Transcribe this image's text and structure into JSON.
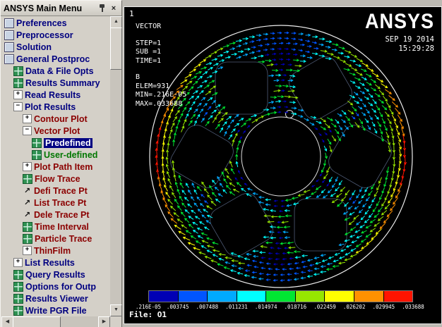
{
  "window": {
    "title": "ANSYS Main Menu"
  },
  "icons": {
    "close": "×",
    "scroll_up": "▲",
    "scroll_down": "▼",
    "scroll_left": "◀",
    "scroll_right": "▶",
    "expand_box": "+",
    "collapse_box": "−",
    "trace_arrow": "↗"
  },
  "colors": {
    "navy": "#000080",
    "maroon": "#8b0000",
    "green": "#007700",
    "selection_bg": "#000082"
  },
  "menu": {
    "items": [
      {
        "label": "Preferences",
        "level": 0,
        "icon": "app",
        "color": "#000080"
      },
      {
        "label": "Preprocessor",
        "level": 0,
        "icon": "app",
        "color": "#000080"
      },
      {
        "label": "Solution",
        "level": 0,
        "icon": "app",
        "color": "#000080"
      },
      {
        "label": "General Postproc",
        "level": 0,
        "icon": "app",
        "color": "#000080"
      },
      {
        "label": "Data & File Opts",
        "level": 1,
        "icon": "table",
        "color": "#000080"
      },
      {
        "label": "Results Summary",
        "level": 1,
        "icon": "table",
        "color": "#000080"
      },
      {
        "label": "Read Results",
        "level": 1,
        "expander": "plus",
        "color": "#000080"
      },
      {
        "label": "Plot Results",
        "level": 1,
        "expander": "minus",
        "color": "#000080"
      },
      {
        "label": "Contour Plot",
        "level": 2,
        "expander": "plus",
        "color": "#8b0000"
      },
      {
        "label": "Vector Plot",
        "level": 2,
        "expander": "minus",
        "color": "#8b0000"
      },
      {
        "label": "Predefined",
        "level": 3,
        "icon": "table",
        "color": "#8b0000",
        "selected": true
      },
      {
        "label": "User-defined",
        "level": 3,
        "icon": "table",
        "color": "#007700"
      },
      {
        "label": "Plot Path Item",
        "level": 2,
        "expander": "plus",
        "color": "#8b0000"
      },
      {
        "label": "Flow Trace",
        "level": 2,
        "icon": "table",
        "color": "#8b0000"
      },
      {
        "label": "Defi Trace Pt",
        "level": 2,
        "icon": "arrow",
        "color": "#8b0000"
      },
      {
        "label": "List Trace Pt",
        "level": 2,
        "icon": "arrow",
        "color": "#8b0000"
      },
      {
        "label": "Dele Trace Pt",
        "level": 2,
        "icon": "arrow",
        "color": "#8b0000"
      },
      {
        "label": "Time Interval",
        "level": 2,
        "icon": "table",
        "color": "#8b0000"
      },
      {
        "label": "Particle Trace",
        "level": 2,
        "icon": "table",
        "color": "#8b0000"
      },
      {
        "label": "ThinFilm",
        "level": 2,
        "expander": "plus",
        "color": "#8b0000"
      },
      {
        "label": "List Results",
        "level": 1,
        "expander": "plus",
        "color": "#000080"
      },
      {
        "label": "Query Results",
        "level": 1,
        "icon": "table",
        "color": "#000080"
      },
      {
        "label": "Options for Outp",
        "level": 1,
        "icon": "table",
        "color": "#000080"
      },
      {
        "label": "Results Viewer",
        "level": 1,
        "icon": "table",
        "color": "#000080"
      },
      {
        "label": "Write PGR File",
        "level": 1,
        "icon": "table",
        "color": "#000080"
      }
    ]
  },
  "viewport": {
    "window_number": "1",
    "info_lines": [
      "VECTOR",
      "STEP=1",
      "SUB =1",
      "TIME=1",
      "B",
      "ELEM=931",
      "MIN=.216E-05",
      "MAX=.033688"
    ],
    "logo": "ANSYS",
    "date": "SEP 19 2014",
    "time": "15:29:28",
    "file_label": "File: O1"
  },
  "colorbar": {
    "colors": [
      "#0000b4",
      "#0055ff",
      "#00aaff",
      "#00ffff",
      "#00e632",
      "#96e600",
      "#ffff00",
      "#ff9100",
      "#ff1400"
    ],
    "labels": [
      ".216E-05",
      ".003745",
      ".007488",
      ".011231",
      ".014974",
      ".018716",
      ".022459",
      ".026202",
      ".029945",
      ".033688"
    ]
  }
}
